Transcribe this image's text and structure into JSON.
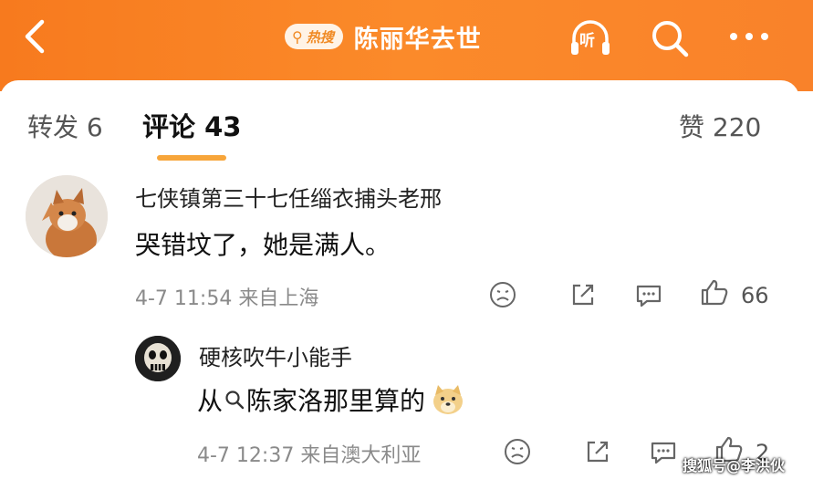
{
  "header": {
    "hot_search_label": "热搜",
    "topic": "陈丽华去世",
    "listen_label": "听"
  },
  "tabs": {
    "forward": "转发 6",
    "comments": "评论 43",
    "likes": "赞 220"
  },
  "comment1": {
    "author": "七侠镇第三十七任缁衣捕头老邢",
    "text": "哭错坟了，她是满人。",
    "meta": "4-7 11:54 来自上海",
    "like_count": "66"
  },
  "comment2": {
    "author": "硬核吹牛小能手",
    "text_prefix": "从",
    "text_main": "陈家洛那里算的",
    "meta": "4-7 12:37 来自澳大利亚",
    "like_count": "2"
  },
  "watermark": "搜狐号@李洪伙",
  "colors": {
    "header_orange": "#f77a1e",
    "tab_accent": "#f7a53a"
  }
}
